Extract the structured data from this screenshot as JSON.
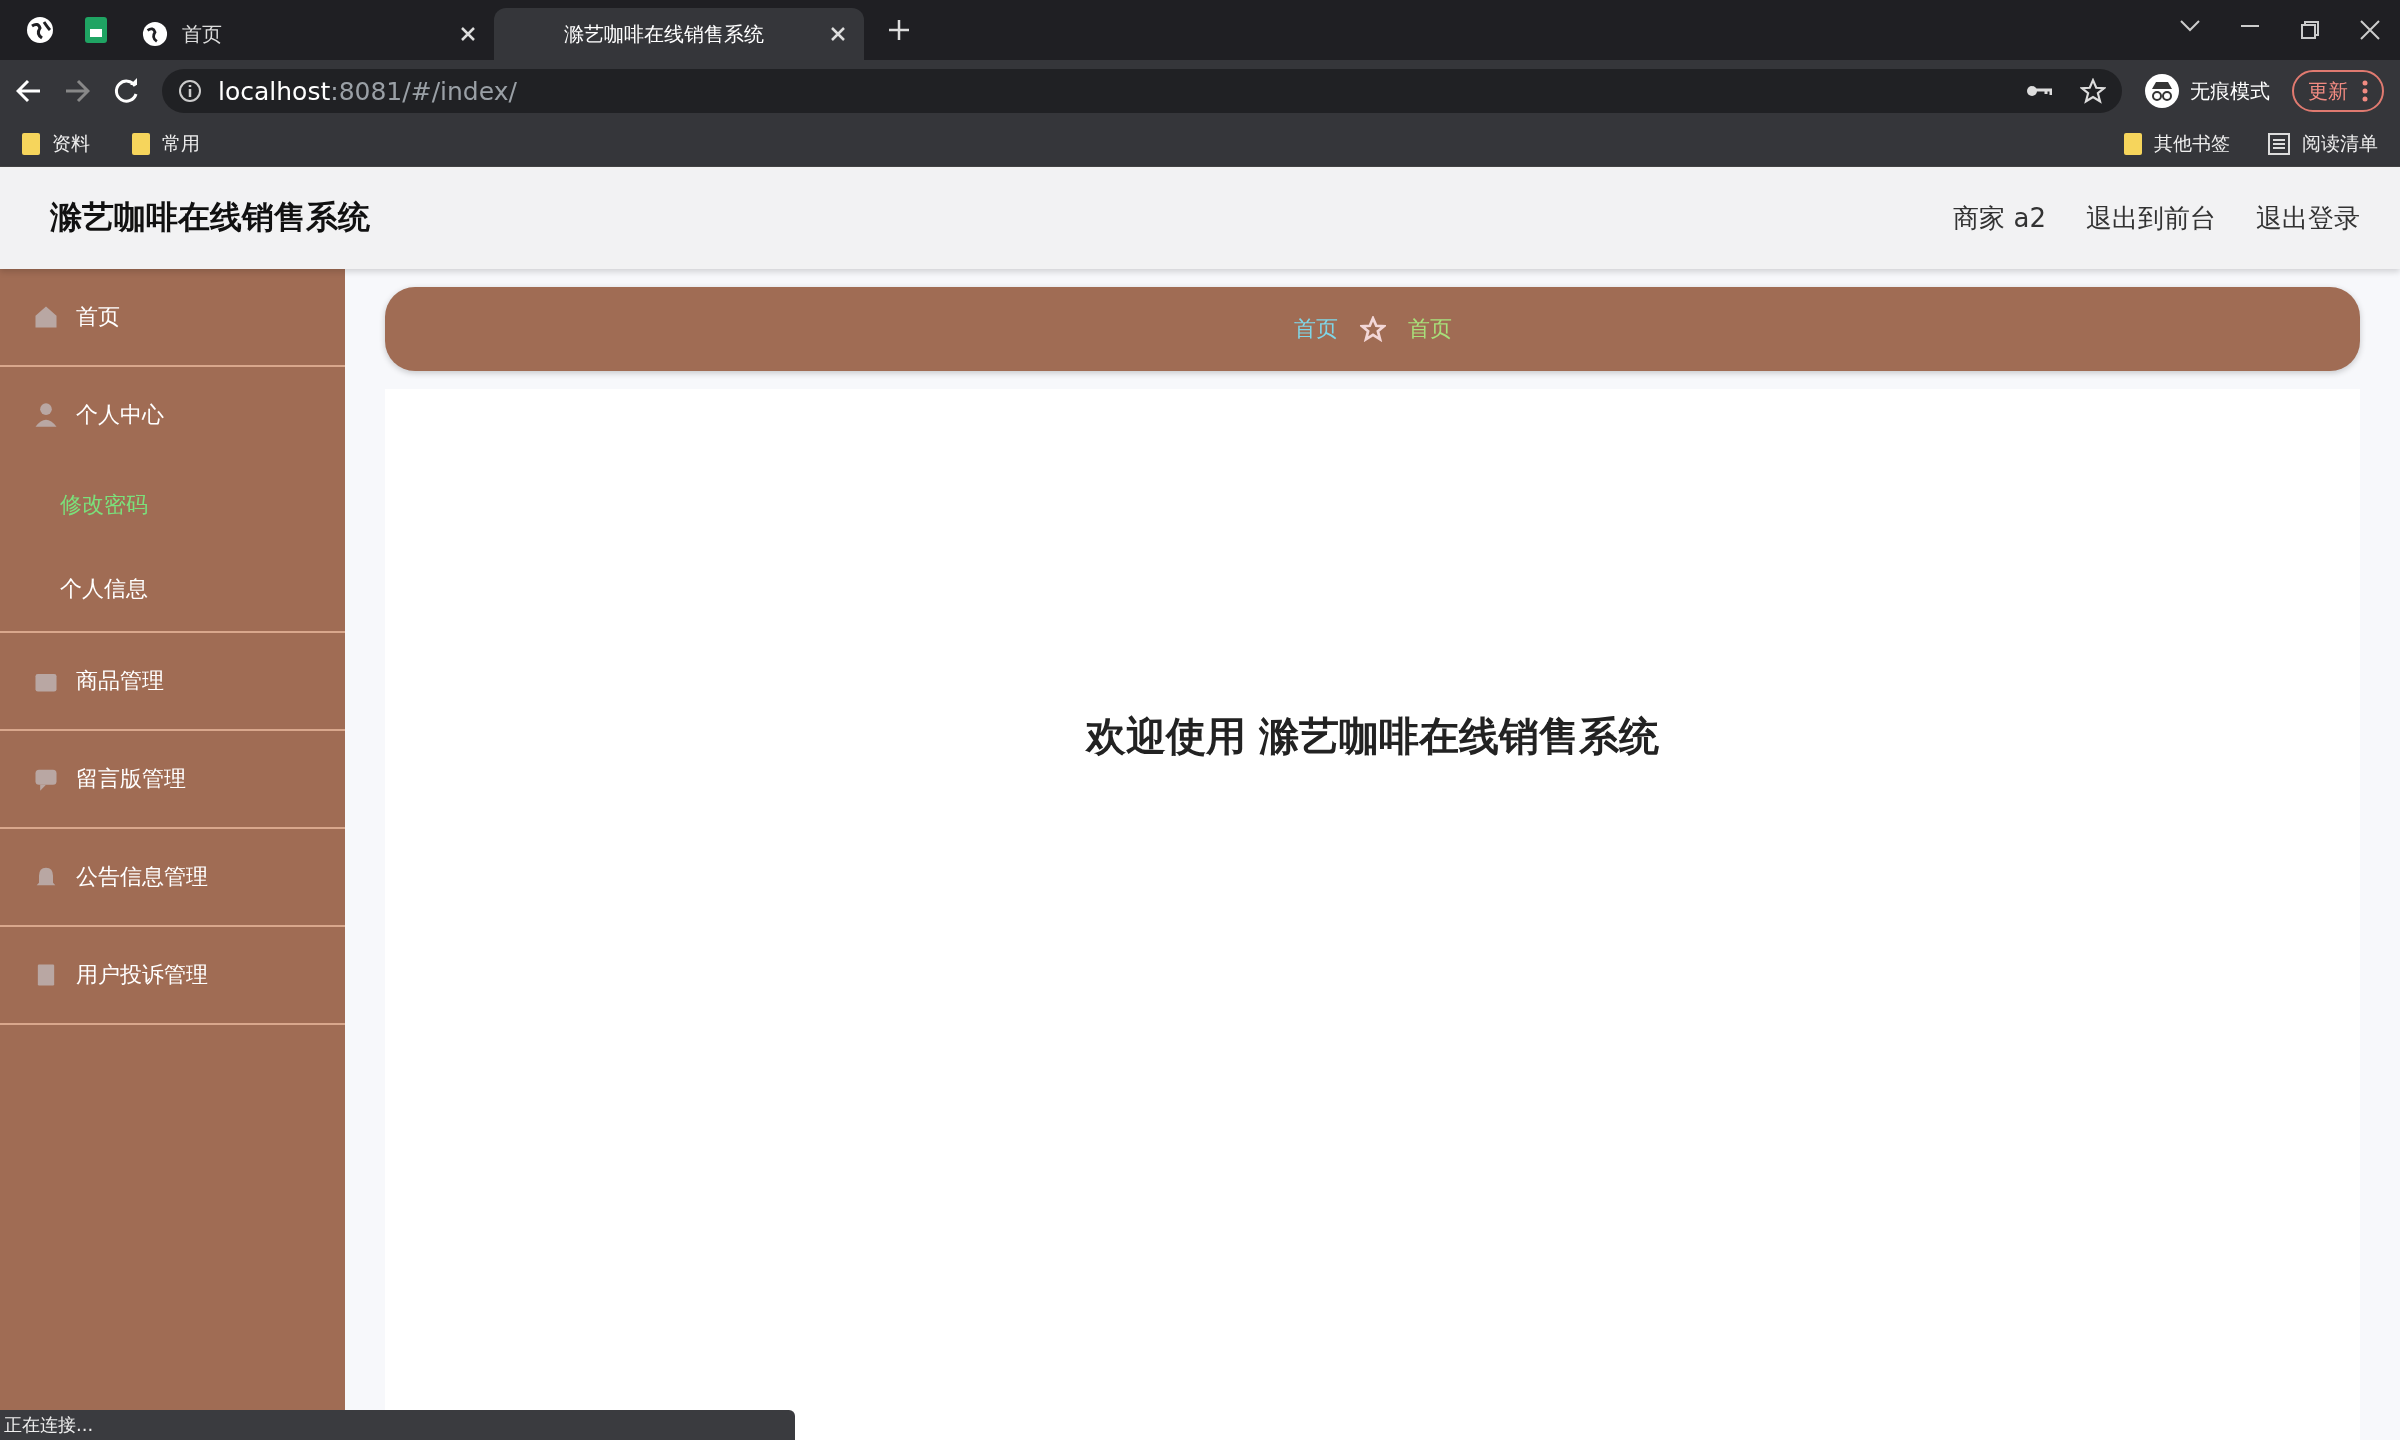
{
  "browser": {
    "tabs": [
      {
        "kind": "pinned",
        "selected": false
      },
      {
        "kind": "pinned",
        "selected": false
      },
      {
        "kind": "normal",
        "title": "首页",
        "selected": false
      },
      {
        "kind": "normal",
        "title": "滁艺咖啡在线销售系统",
        "selected": true
      }
    ],
    "address": {
      "host": "localhost",
      "path": ":8081/#/index/"
    },
    "profile_label": "无痕模式",
    "update_button": "更新",
    "bookmarks": [
      {
        "label": "资料"
      },
      {
        "label": "常用"
      }
    ],
    "bookmarks_right": [
      {
        "kind": "folder",
        "label": "其他书签"
      },
      {
        "kind": "list",
        "label": "阅读清单"
      }
    ]
  },
  "header": {
    "title": "滁艺咖啡在线销售系统",
    "user": "商家 a2",
    "links": [
      "退出到前台",
      "退出登录"
    ]
  },
  "sidebar": {
    "items": [
      {
        "label": "首页"
      },
      {
        "label": "个人中心",
        "children": [
          {
            "label": "修改密码",
            "selected": true
          },
          {
            "label": "个人信息",
            "selected": false
          }
        ]
      },
      {
        "label": "商品管理"
      },
      {
        "label": "留言版管理"
      },
      {
        "label": "公告信息管理"
      },
      {
        "label": "用户投诉管理"
      }
    ]
  },
  "breadcrumb": [
    "首页",
    "首页"
  ],
  "welcome": "欢迎使用 滁艺咖啡在线销售系统",
  "status_bar": "正在连接..."
}
